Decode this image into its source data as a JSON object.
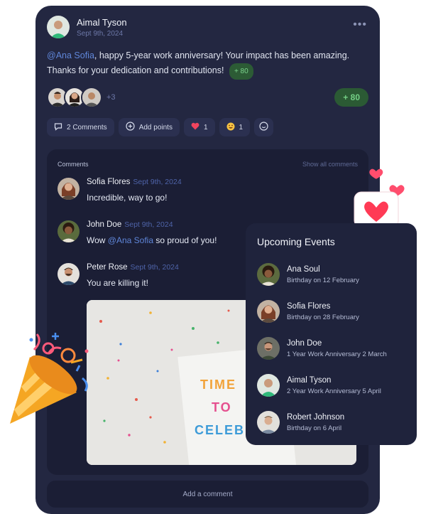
{
  "post": {
    "author": "Aimal Tyson",
    "date": "Sept 9th, 2024",
    "more_icon": "•••",
    "mention": "@Ana Sofia",
    "text_line1": ", happy 5-year work anniversary! Your impact has been amazing.",
    "text_line2": "Thanks for your dedication and contributions!",
    "inline_points": "+ 80",
    "reactors_more": "+3",
    "points_badge": "+ 80"
  },
  "actions": {
    "comments": "2 Comments",
    "add_points": "Add points",
    "heart_count": "1",
    "laugh_count": "1"
  },
  "comments": {
    "header": "Comments",
    "show_all": "Show all comments",
    "items": [
      {
        "name": "Sofia Flores",
        "date": "Sept 9th, 2024",
        "text": "Incredible, way to go!"
      },
      {
        "name": "John Doe",
        "date": "Sept 9th, 2024",
        "text_pre": "Wow ",
        "mention": "@Ana Sofia",
        "text_post": " so proud of you!"
      },
      {
        "name": "Peter Rose",
        "date": "Sept 9th, 2024",
        "text": "You are killing it!"
      }
    ],
    "photo_text": [
      "TIME",
      "TO",
      "CELEBRA"
    ],
    "add_placeholder": "Add a comment"
  },
  "events": {
    "title": "Upcoming Events",
    "items": [
      {
        "name": "Ana Soul",
        "desc": "Birthday on 12 February"
      },
      {
        "name": "Sofia Flores",
        "desc": "Birthday on 28 February"
      },
      {
        "name": "John Doe",
        "desc": "1 Year Work Anniversary 2 March"
      },
      {
        "name": "Aimal Tyson",
        "desc": "2 Year Work Anniversary 5 April"
      },
      {
        "name": "Robert Johnson",
        "desc": "Birthday on 6 April"
      }
    ]
  },
  "colors": {
    "card": "#232741",
    "panel": "#1b1e35",
    "accent_green": "#74cf86",
    "mention_blue": "#5f86d9",
    "heart_red": "#f0445e"
  },
  "icons": [
    "more-icon",
    "comment-icon",
    "plus-circle-icon",
    "heart-icon",
    "laugh-emoji-icon",
    "add-reaction-icon",
    "heart-speech-bubble-icon",
    "party-popper-icon"
  ]
}
